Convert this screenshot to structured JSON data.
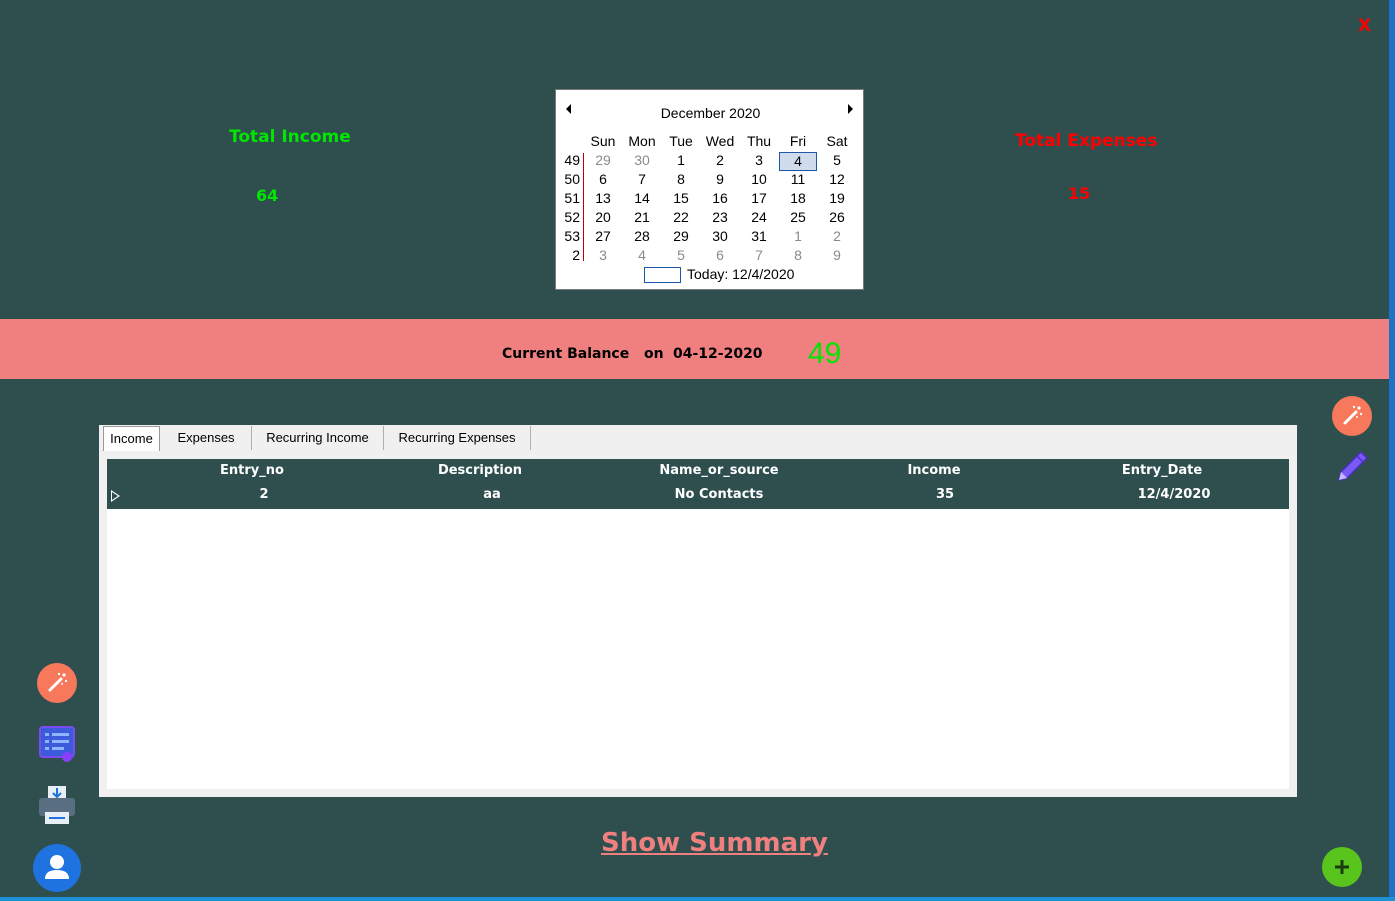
{
  "close_label": "X",
  "summary": {
    "total_income_label": "Total Income",
    "total_income_value": "64",
    "total_expenses_label": "Total Expenses",
    "total_expenses_value": "15"
  },
  "calendar": {
    "month_title": "December 2020",
    "day_headers": [
      "Sun",
      "Mon",
      "Tue",
      "Wed",
      "Thu",
      "Fri",
      "Sat"
    ],
    "weeks": [
      {
        "wk": "49",
        "days": [
          "29",
          "30",
          "1",
          "2",
          "3",
          "4",
          "5"
        ]
      },
      {
        "wk": "50",
        "days": [
          "6",
          "7",
          "8",
          "9",
          "10",
          "11",
          "12"
        ]
      },
      {
        "wk": "51",
        "days": [
          "13",
          "14",
          "15",
          "16",
          "17",
          "18",
          "19"
        ]
      },
      {
        "wk": "52",
        "days": [
          "20",
          "21",
          "22",
          "23",
          "24",
          "25",
          "26"
        ]
      },
      {
        "wk": "53",
        "days": [
          "27",
          "28",
          "29",
          "30",
          "31",
          "1",
          "2"
        ]
      },
      {
        "wk": "2",
        "days": [
          "3",
          "4",
          "5",
          "6",
          "7",
          "8",
          "9"
        ]
      }
    ],
    "selected_day": "4",
    "today_label": "Today: 12/4/2020"
  },
  "balance": {
    "label": "Current Balance",
    "on_label": "on",
    "date": "04-12-2020",
    "value": "49"
  },
  "tabs": [
    "Income",
    "Expenses",
    "Recurring Income",
    "Recurring Expenses"
  ],
  "active_tab": "Income",
  "table": {
    "columns": [
      "Entry_no",
      "Description",
      "Name_or_source",
      "Income",
      "Entry_Date"
    ],
    "rows": [
      [
        "2",
        "aa",
        "No Contacts",
        "35",
        "12/4/2020"
      ]
    ]
  },
  "show_summary_label": "Show Summary",
  "colors": {
    "background": "#2f4f4f",
    "income": "#00e600",
    "expenses": "#ff0000",
    "balance_band": "#f08080"
  },
  "icons": [
    "magic-wand-icon",
    "pencil-icon",
    "report-list-icon",
    "printer-icon",
    "user-icon",
    "add-icon"
  ]
}
